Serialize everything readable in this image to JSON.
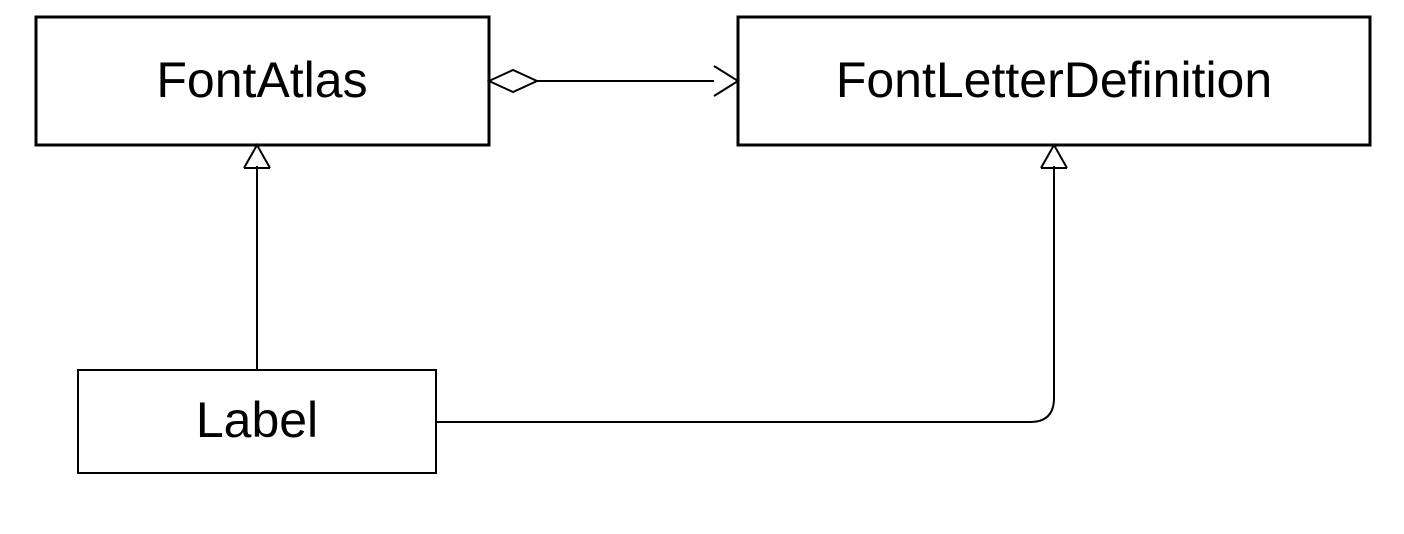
{
  "diagram": {
    "nodes": {
      "fontAtlas": {
        "label": "FontAtlas"
      },
      "fontLetterDefinition": {
        "label": "FontLetterDefinition"
      },
      "label": {
        "label": "Label"
      }
    },
    "edges": [
      {
        "from": "fontAtlas",
        "to": "fontLetterDefinition",
        "type": "aggregation"
      },
      {
        "from": "label",
        "to": "fontAtlas",
        "type": "association"
      },
      {
        "from": "label",
        "to": "fontLetterDefinition",
        "type": "association"
      }
    ]
  }
}
